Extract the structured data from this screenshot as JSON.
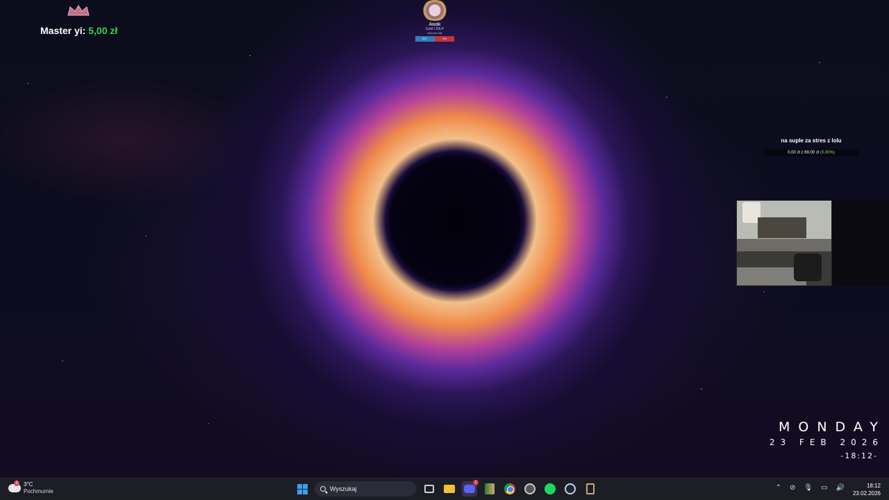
{
  "overlay": {
    "master_label": "Master yi:",
    "master_value": "5,00 zł"
  },
  "rank": {
    "name": "Awak",
    "tier": "Gold I 20LP",
    "sub": "Winrate h8k",
    "wins": "207·",
    "losses": "2%"
  },
  "goal": {
    "title": "na suple za stres z lolu",
    "current": "0,00 zł",
    "separator": "z",
    "target": "69,00 zł",
    "percent": "(0.00%)"
  },
  "clock_widget": {
    "day": "MONDAY",
    "date": "23 FEB 2026",
    "time": "-18:12-"
  },
  "taskbar": {
    "weather": {
      "temp": "3°C",
      "condition": "Pochmurnie",
      "badge": "1"
    },
    "search_placeholder": "Wyszukaj",
    "discord_badge": "1",
    "time": "18:12",
    "date": "23.02.2026",
    "icons": [
      "windows-start",
      "task-view",
      "file-explorer",
      "discord",
      "app-green-book",
      "chrome",
      "app-circle",
      "spotify",
      "steam",
      "league-of-legends"
    ],
    "colors": {
      "accent": "#3aa0f0",
      "discord": "#5865f2",
      "spotify": "#1ed760"
    }
  }
}
